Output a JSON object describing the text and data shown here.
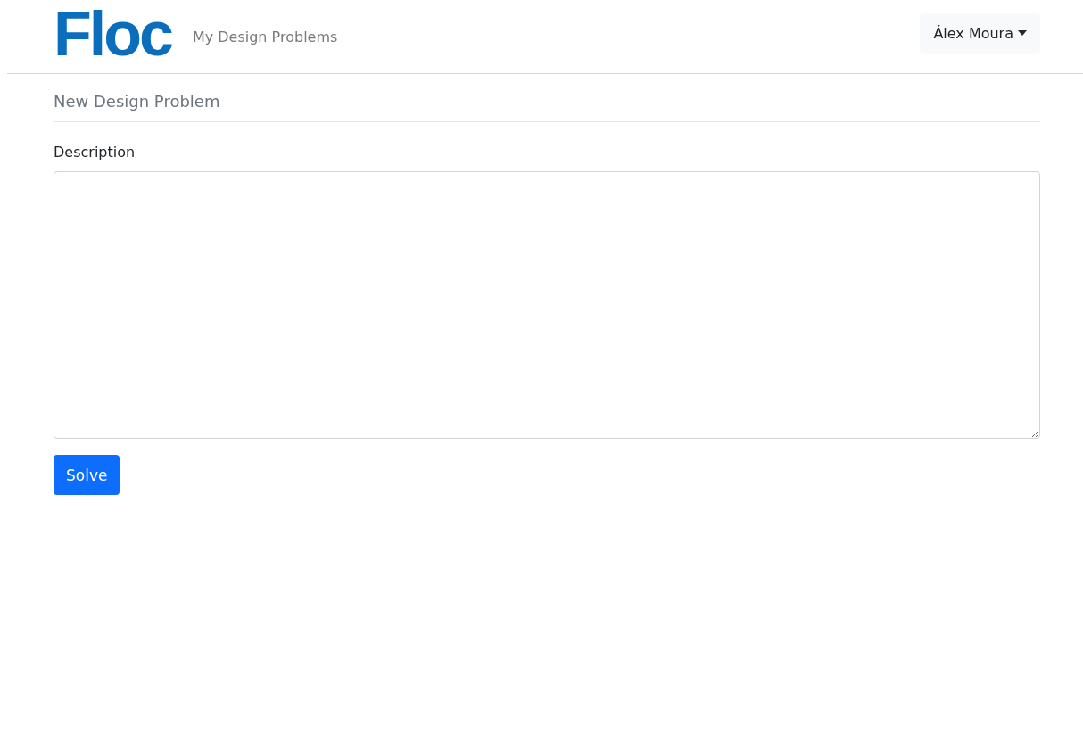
{
  "navbar": {
    "brand": "Floc",
    "links": [
      "My Design Problems"
    ],
    "user_menu": {
      "label": "Álex Moura"
    }
  },
  "form": {
    "title": "New Design Problem",
    "fields": [
      {
        "label": "Description",
        "kind": "textarea"
      }
    ],
    "submit": "Solve"
  }
}
